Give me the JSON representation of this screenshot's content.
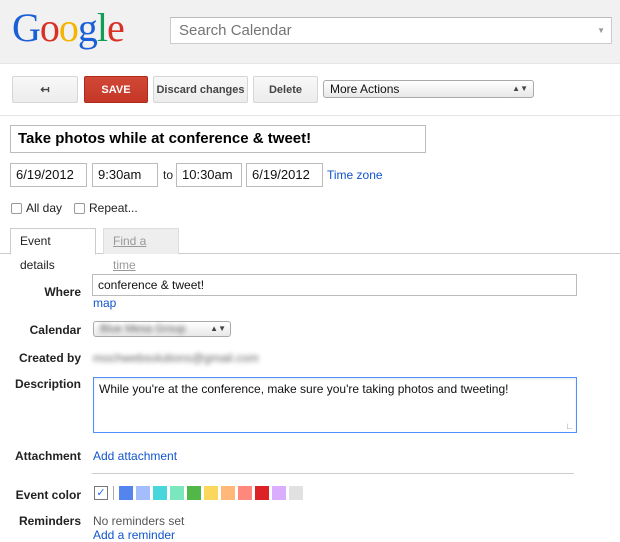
{
  "app": {
    "logo": [
      "G",
      "o",
      "o",
      "g",
      "l",
      "e"
    ],
    "logo_colors": [
      "#1a5fd6",
      "#d93025",
      "#f4b400",
      "#1a5fd6",
      "#0f9d58",
      "#d93025"
    ]
  },
  "search": {
    "placeholder": "Search Calendar"
  },
  "toolbar": {
    "back_label": "↤",
    "save_label": "SAVE",
    "discard_label": "Discard changes",
    "delete_label": "Delete",
    "more_actions_label": "More Actions"
  },
  "event": {
    "title": "Take photos while at conference & tweet!",
    "start_date": "6/19/2012",
    "start_time": "9:30am",
    "to_label": "to",
    "end_time": "10:30am",
    "end_date": "6/19/2012",
    "timezone_label": "Time zone",
    "allday_label": "All day",
    "repeat_label": "Repeat..."
  },
  "tabs": {
    "details": "Event details",
    "find_time": "Find a time"
  },
  "details": {
    "where_label": "Where",
    "where_value": "conference & tweet!",
    "map_label": "map",
    "calendar_label": "Calendar",
    "calendar_value": "Blue Mesa Group",
    "created_by_label": "Created by",
    "created_by_value": "mochwebsolutions@gmail.com",
    "description_label": "Description",
    "description_value": "While you're at the conference, make sure you're taking photos and tweeting!",
    "attachment_label": "Attachment",
    "add_attachment_label": "Add attachment",
    "event_color_label": "Event color",
    "event_colors": [
      "#5484ed",
      "#a4bdfc",
      "#46d6db",
      "#7ae7bf",
      "#51b749",
      "#fbd75b",
      "#ffb878",
      "#ff887c",
      "#dc2127",
      "#dbadff",
      "#e1e1e1"
    ],
    "reminders_label": "Reminders",
    "no_reminders": "No reminders set",
    "add_reminder_label": "Add a reminder"
  }
}
